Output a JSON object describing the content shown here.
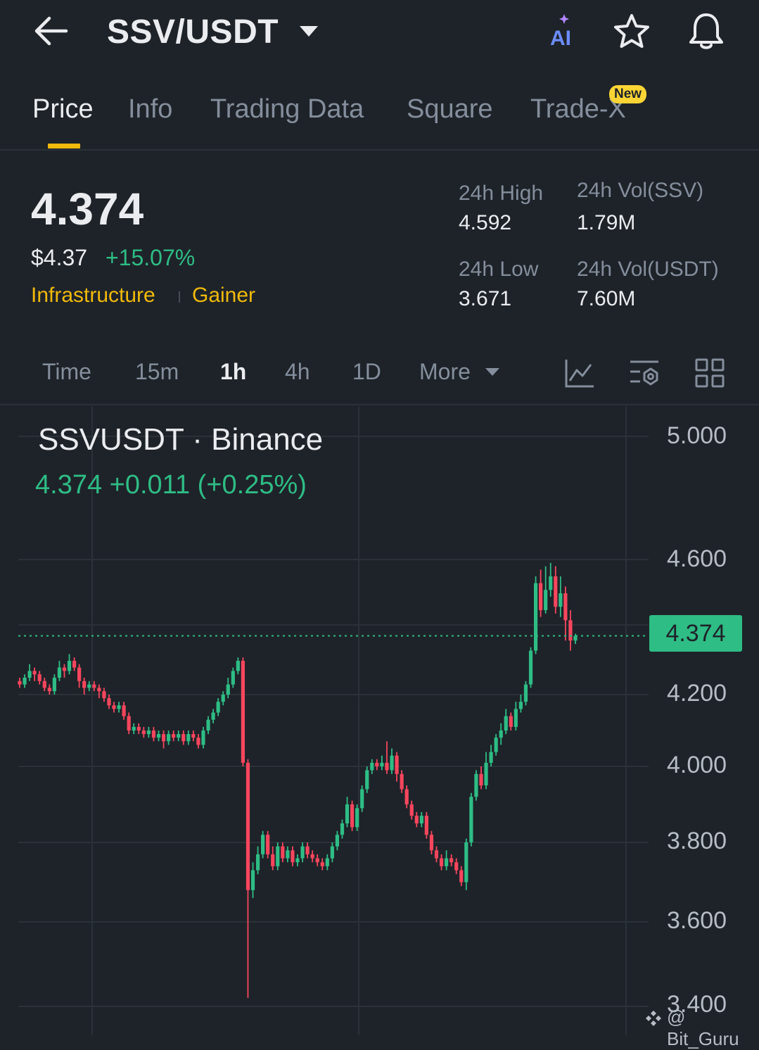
{
  "header": {
    "pair": "SSV/USDT",
    "ai_label": "AI",
    "icons": [
      "back-arrow-icon",
      "chevron-down-icon",
      "ai-icon",
      "star-icon",
      "bell-icon"
    ]
  },
  "tabs": [
    {
      "label": "Price",
      "active": true
    },
    {
      "label": "Info",
      "active": false
    },
    {
      "label": "Trading Data",
      "active": false
    },
    {
      "label": "Square",
      "active": false
    },
    {
      "label": "Trade-X",
      "active": false,
      "badge": "New"
    }
  ],
  "ticker": {
    "last_price": "4.374",
    "usd_price": "$4.37",
    "change_pct": "+15.07%",
    "tags": [
      "Infrastructure",
      "Gainer"
    ],
    "stats": {
      "high_label": "24h High",
      "high_value": "4.592",
      "low_label": "24h Low",
      "low_value": "3.671",
      "vol_base_label": "24h Vol(SSV)",
      "vol_base_value": "1.79M",
      "vol_quote_label": "24h Vol(USDT)",
      "vol_quote_value": "7.60M"
    }
  },
  "intervals": {
    "items": [
      "Time",
      "15m",
      "1h",
      "4h",
      "1D"
    ],
    "active": "1h",
    "more_label": "More",
    "tool_icons": [
      "indicator-icon",
      "chart-settings-icon",
      "layout-grid-icon"
    ]
  },
  "colors": {
    "background": "#1e2329",
    "up": "#2ebd85",
    "down": "#f6465d",
    "accent": "#f0b90b",
    "text_primary": "#eaecef",
    "text_secondary": "#848e9c"
  },
  "chart_header": {
    "title": "SSVUSDT · Binance",
    "quote": "4.374  +0.011 (+0.25%)",
    "current_price_tag": "4.374"
  },
  "watermark": "@ Bit_Guru",
  "chart_data": {
    "type": "candlestick",
    "symbol": "SSVUSDT",
    "exchange": "Binance",
    "interval": "1h",
    "y_ticks": [
      "5.000",
      "4.600",
      "4.200",
      "4.000",
      "3.800",
      "3.600",
      "3.400"
    ],
    "y_tick_values": [
      5.0,
      4.6,
      4.2,
      4.0,
      3.8,
      3.6,
      3.4
    ],
    "current_price": 4.374,
    "grid": true,
    "candles": [
      [
        4.24,
        4.23,
        4.25,
        4.22
      ],
      [
        4.23,
        4.25,
        4.26,
        4.22
      ],
      [
        4.25,
        4.27,
        4.29,
        4.24
      ],
      [
        4.27,
        4.26,
        4.28,
        4.24
      ],
      [
        4.26,
        4.24,
        4.27,
        4.23
      ],
      [
        4.24,
        4.22,
        4.25,
        4.21
      ],
      [
        4.22,
        4.21,
        4.23,
        4.2
      ],
      [
        4.21,
        4.25,
        4.26,
        4.2
      ],
      [
        4.25,
        4.28,
        4.3,
        4.24
      ],
      [
        4.28,
        4.27,
        4.29,
        4.25
      ],
      [
        4.27,
        4.3,
        4.32,
        4.26
      ],
      [
        4.3,
        4.28,
        4.31,
        4.27
      ],
      [
        4.28,
        4.24,
        4.29,
        4.22
      ],
      [
        4.24,
        4.22,
        4.25,
        4.2
      ],
      [
        4.22,
        4.23,
        4.24,
        4.21
      ],
      [
        4.23,
        4.22,
        4.24,
        4.21
      ],
      [
        4.22,
        4.21,
        4.23,
        4.19
      ],
      [
        4.21,
        4.19,
        4.22,
        4.18
      ],
      [
        4.19,
        4.17,
        4.2,
        4.16
      ],
      [
        4.17,
        4.16,
        4.18,
        4.15
      ],
      [
        4.16,
        4.17,
        4.18,
        4.15
      ],
      [
        4.17,
        4.14,
        4.18,
        4.13
      ],
      [
        4.14,
        4.1,
        4.15,
        4.09
      ],
      [
        4.1,
        4.11,
        4.12,
        4.09
      ],
      [
        4.11,
        4.1,
        4.12,
        4.09
      ],
      [
        4.1,
        4.09,
        4.11,
        4.08
      ],
      [
        4.09,
        4.1,
        4.11,
        4.08
      ],
      [
        4.1,
        4.08,
        4.11,
        4.07
      ],
      [
        4.08,
        4.09,
        4.1,
        4.07
      ],
      [
        4.09,
        4.07,
        4.1,
        4.05
      ],
      [
        4.07,
        4.09,
        4.1,
        4.06
      ],
      [
        4.09,
        4.08,
        4.1,
        4.07
      ],
      [
        4.08,
        4.09,
        4.1,
        4.07
      ],
      [
        4.09,
        4.07,
        4.1,
        4.06
      ],
      [
        4.07,
        4.09,
        4.1,
        4.06
      ],
      [
        4.09,
        4.08,
        4.1,
        4.07
      ],
      [
        4.08,
        4.06,
        4.09,
        4.05
      ],
      [
        4.06,
        4.1,
        4.11,
        4.05
      ],
      [
        4.1,
        4.13,
        4.14,
        4.09
      ],
      [
        4.13,
        4.15,
        4.16,
        4.12
      ],
      [
        4.15,
        4.18,
        4.19,
        4.14
      ],
      [
        4.18,
        4.2,
        4.21,
        4.17
      ],
      [
        4.2,
        4.23,
        4.25,
        4.19
      ],
      [
        4.23,
        4.27,
        4.28,
        4.22
      ],
      [
        4.27,
        4.3,
        4.31,
        4.26
      ],
      [
        4.3,
        4.01,
        4.31,
        4.0
      ],
      [
        4.01,
        3.68,
        4.02,
        3.42
      ],
      [
        3.68,
        3.73,
        3.75,
        3.66
      ],
      [
        3.73,
        3.77,
        3.79,
        3.72
      ],
      [
        3.77,
        3.82,
        3.83,
        3.76
      ],
      [
        3.82,
        3.77,
        3.83,
        3.76
      ],
      [
        3.77,
        3.74,
        3.79,
        3.73
      ],
      [
        3.74,
        3.79,
        3.8,
        3.73
      ],
      [
        3.79,
        3.76,
        3.8,
        3.75
      ],
      [
        3.76,
        3.78,
        3.79,
        3.75
      ],
      [
        3.78,
        3.75,
        3.79,
        3.74
      ],
      [
        3.75,
        3.76,
        3.77,
        3.74
      ],
      [
        3.76,
        3.79,
        3.8,
        3.75
      ],
      [
        3.79,
        3.77,
        3.8,
        3.76
      ],
      [
        3.77,
        3.76,
        3.78,
        3.75
      ],
      [
        3.76,
        3.75,
        3.77,
        3.74
      ],
      [
        3.75,
        3.74,
        3.76,
        3.73
      ],
      [
        3.74,
        3.76,
        3.77,
        3.73
      ],
      [
        3.76,
        3.79,
        3.8,
        3.75
      ],
      [
        3.79,
        3.82,
        3.83,
        3.78
      ],
      [
        3.82,
        3.85,
        3.86,
        3.81
      ],
      [
        3.85,
        3.9,
        3.92,
        3.84
      ],
      [
        3.9,
        3.84,
        3.91,
        3.83
      ],
      [
        3.84,
        3.89,
        3.9,
        3.83
      ],
      [
        3.89,
        3.94,
        3.95,
        3.88
      ],
      [
        3.94,
        3.99,
        4.0,
        3.93
      ],
      [
        3.99,
        4.01,
        4.02,
        3.98
      ],
      [
        4.01,
        4.0,
        4.02,
        3.99
      ],
      [
        4.0,
        4.01,
        4.03,
        3.99
      ],
      [
        4.01,
        3.99,
        4.07,
        3.98
      ],
      [
        3.99,
        4.03,
        4.05,
        3.98
      ],
      [
        4.03,
        3.98,
        4.04,
        3.96
      ],
      [
        3.98,
        3.94,
        3.99,
        3.93
      ],
      [
        3.94,
        3.9,
        3.95,
        3.89
      ],
      [
        3.9,
        3.87,
        3.91,
        3.86
      ],
      [
        3.87,
        3.85,
        3.88,
        3.84
      ],
      [
        3.85,
        3.87,
        3.88,
        3.84
      ],
      [
        3.87,
        3.82,
        3.88,
        3.81
      ],
      [
        3.82,
        3.78,
        3.83,
        3.77
      ],
      [
        3.78,
        3.76,
        3.79,
        3.75
      ],
      [
        3.76,
        3.74,
        3.77,
        3.73
      ],
      [
        3.74,
        3.76,
        3.78,
        3.73
      ],
      [
        3.76,
        3.75,
        3.77,
        3.74
      ],
      [
        3.75,
        3.73,
        3.76,
        3.72
      ],
      [
        3.73,
        3.7,
        3.74,
        3.69
      ],
      [
        3.7,
        3.8,
        3.81,
        3.68
      ],
      [
        3.8,
        3.92,
        3.93,
        3.79
      ],
      [
        3.92,
        3.98,
        3.99,
        3.91
      ],
      [
        3.98,
        3.95,
        4.0,
        3.94
      ],
      [
        3.95,
        4.01,
        4.04,
        3.94
      ],
      [
        4.01,
        4.04,
        4.06,
        4.0
      ],
      [
        4.04,
        4.08,
        4.09,
        4.03
      ],
      [
        4.08,
        4.1,
        4.12,
        4.06
      ],
      [
        4.1,
        4.14,
        4.16,
        4.09
      ],
      [
        4.14,
        4.11,
        4.15,
        4.1
      ],
      [
        4.11,
        4.16,
        4.18,
        4.1
      ],
      [
        4.16,
        4.18,
        4.2,
        4.15
      ],
      [
        4.18,
        4.23,
        4.24,
        4.17
      ],
      [
        4.23,
        4.33,
        4.34,
        4.22
      ],
      [
        4.33,
        4.53,
        4.55,
        4.32
      ],
      [
        4.53,
        4.45,
        4.57,
        4.43
      ],
      [
        4.45,
        4.51,
        4.58,
        4.44
      ],
      [
        4.51,
        4.55,
        4.59,
        4.49
      ],
      [
        4.55,
        4.46,
        4.58,
        4.44
      ],
      [
        4.46,
        4.5,
        4.55,
        4.43
      ],
      [
        4.5,
        4.42,
        4.52,
        4.36
      ],
      [
        4.42,
        4.36,
        4.45,
        4.33
      ],
      [
        4.36,
        4.374,
        4.38,
        4.35
      ]
    ]
  }
}
